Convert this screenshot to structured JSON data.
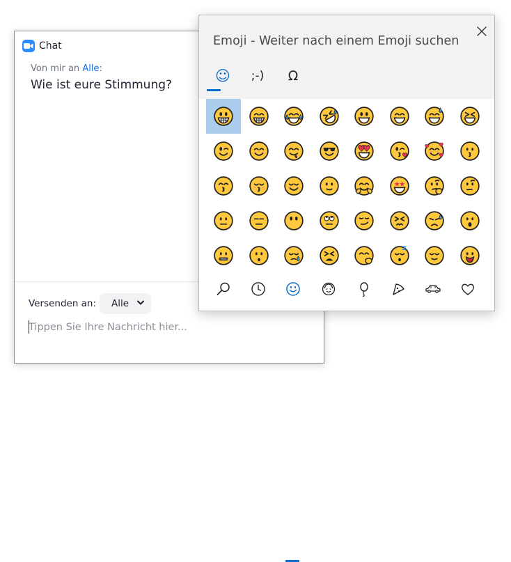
{
  "chat": {
    "title": "Chat",
    "message": {
      "meta_prefix": "Von mir an",
      "recipient": "Alle",
      "meta_suffix": ":",
      "text": "Wie ist eure Stimmung?"
    },
    "send_to_label": "Versenden an:",
    "recipient_select": {
      "value": "Alle"
    },
    "input": {
      "value": "",
      "placeholder": "Tippen Sie Ihre Nachricht hier..."
    }
  },
  "emoji_panel": {
    "title": "Emoji - Weiter nach einem Emoji suchen",
    "tabs": [
      {
        "name": "emoji",
        "glyph": "☺"
      },
      {
        "name": "kaomoji",
        "glyph": ";-)"
      },
      {
        "name": "symbols",
        "glyph": "Ω"
      }
    ],
    "active_tab": 0,
    "selected_emoji": 0,
    "emojis": [
      "grinning-face",
      "beaming-face-with-smiling-eyes",
      "face-with-tears-of-joy",
      "rolling-on-the-floor-laughing",
      "grinning-face-with-big-eyes",
      "grinning-face-with-smiling-eyes",
      "grinning-face-with-sweat",
      "grinning-squinting-face",
      "winking-face",
      "smiling-face-with-smiling-eyes",
      "face-savoring-food",
      "smiling-face-with-sunglasses",
      "smiling-face-with-heart-eyes",
      "face-blowing-a-kiss",
      "smiling-face-with-hearts",
      "kissing-face",
      "kissing-face-with-smiling-eyes",
      "kissing-face-with-closed-eyes",
      "smiling-face",
      "slightly-smiling-face",
      "hugging-face",
      "star-struck",
      "thinking-face",
      "face-with-raised-eyebrow",
      "neutral-face",
      "expressionless-face",
      "face-without-mouth",
      "face-with-rolling-eyes",
      "smirking-face",
      "persevering-face",
      "sad-but-relieved-face",
      "face-with-open-mouth",
      "zipper-mouth-face",
      "hushed-face",
      "sleepy-face",
      "tired-face",
      "face-with-hand-over-mouth",
      "sleeping-face",
      "relieved-face",
      "face-with-tongue"
    ],
    "categories": [
      {
        "name": "search"
      },
      {
        "name": "recent"
      },
      {
        "name": "smileys"
      },
      {
        "name": "people"
      },
      {
        "name": "celebration"
      },
      {
        "name": "food"
      },
      {
        "name": "travel"
      },
      {
        "name": "symbols"
      }
    ],
    "active_category": 2,
    "colors": {
      "accent": "#0b6cc9",
      "selected_bg": "#a9cdeb",
      "emoji_face": "#ffc83d",
      "emoji_outline": "#222222",
      "zoom_blue": "#2d8cff",
      "link_blue": "#0e71eb"
    }
  }
}
